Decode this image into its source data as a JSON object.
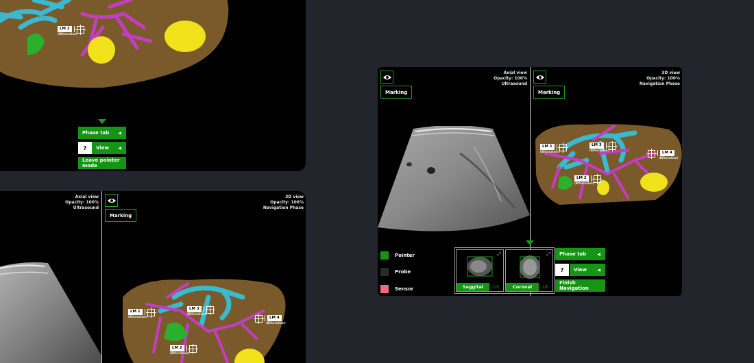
{
  "colors": {
    "accent_green": "#149614",
    "liver_brown": "#7a5a2a",
    "vessel_cyan": "#3bb9d0",
    "vessel_magenta": "#c63cc6",
    "tumor_yellow": "#f2e21c",
    "probe_swatch": "#2a2a2a",
    "sensor_swatch": "#f06b7c"
  },
  "top_left_panel": {
    "landmarks": [
      {
        "label": "LM 2",
        "sub": "(Bifurcation)"
      }
    ],
    "menu": {
      "phase_tab": "Phase tab",
      "question": "?",
      "view": "View",
      "leave_pointer": "Leave pointer mode",
      "caret": "◀"
    }
  },
  "bottom_left_panel": {
    "axial": {
      "title": "Axial view",
      "opacity": "Opacity: 100%",
      "mode": "Ultrasound"
    },
    "three_d": {
      "title": "3D view",
      "opacity": "Opacity: 100%",
      "mode": "Navigation Phase"
    },
    "marking": "Marking",
    "landmarks": [
      {
        "label": "LM 1",
        "sub": "(Bifurcation)"
      },
      {
        "label": "LM 3",
        "sub": "(Bifurcation)"
      },
      {
        "label": "LM 4",
        "sub": "(Bifurcation)"
      },
      {
        "label": "LM 2",
        "sub": "(Bifurcation)"
      }
    ]
  },
  "main_panel": {
    "axial": {
      "title": "Axial view",
      "opacity": "Opacity: 100%",
      "mode": "Ultrasound"
    },
    "three_d": {
      "title": "3D view",
      "opacity": "Opacity: 100%",
      "mode": "Navigation Phase"
    },
    "marking_left": "Marking",
    "marking_right": "Marking",
    "landmarks": [
      {
        "label": "LM 1",
        "sub": "(Bifurcation)"
      },
      {
        "label": "LM 3",
        "sub": "(Bifurcation)"
      },
      {
        "label": "LM 4",
        "sub": "(Bifurcation)"
      },
      {
        "label": "LM 2",
        "sub": "(Bifurcation)"
      }
    ],
    "legend": [
      {
        "label": "Pointer",
        "color": "#149614"
      },
      {
        "label": "Probe",
        "color": "#2a2a2a"
      },
      {
        "label": "Sensor",
        "color": "#f06b7c"
      }
    ],
    "thumbnails": [
      {
        "name": "Saggital",
        "tag": "US"
      },
      {
        "name": "Coronal",
        "tag": "US"
      }
    ],
    "menu": {
      "phase_tab": "Phase tab",
      "question": "?",
      "view": "View",
      "finish": "Finish Navigation",
      "caret": "◀"
    }
  }
}
